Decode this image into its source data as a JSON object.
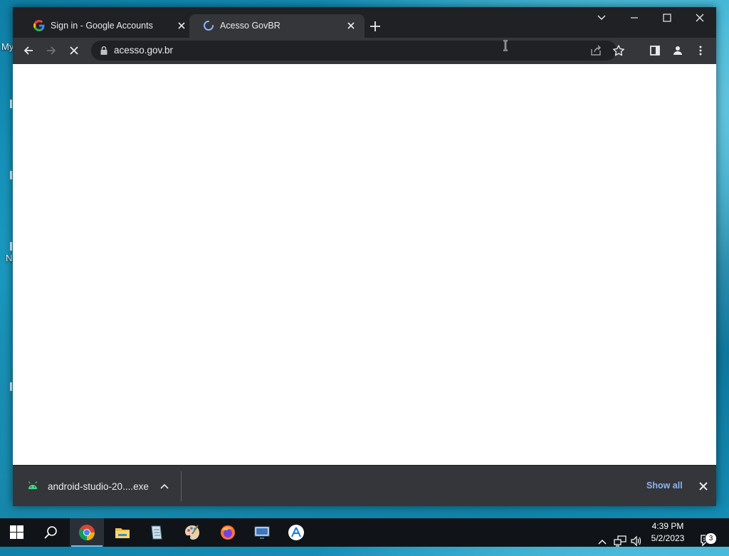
{
  "desktop": {
    "labels": [
      "My",
      "N"
    ]
  },
  "browser": {
    "tabs": [
      {
        "title": "Sign in - Google Accounts",
        "active": false
      },
      {
        "title": "Acesso GovBR",
        "active": true
      }
    ],
    "address": {
      "url": "acesso.gov.br"
    }
  },
  "downloads": {
    "file_name": "android-studio-20....exe",
    "show_all_label": "Show all"
  },
  "taskbar": {
    "clock_time": "4:39 PM",
    "clock_date": "5/2/2023",
    "notification_count": "3"
  }
}
